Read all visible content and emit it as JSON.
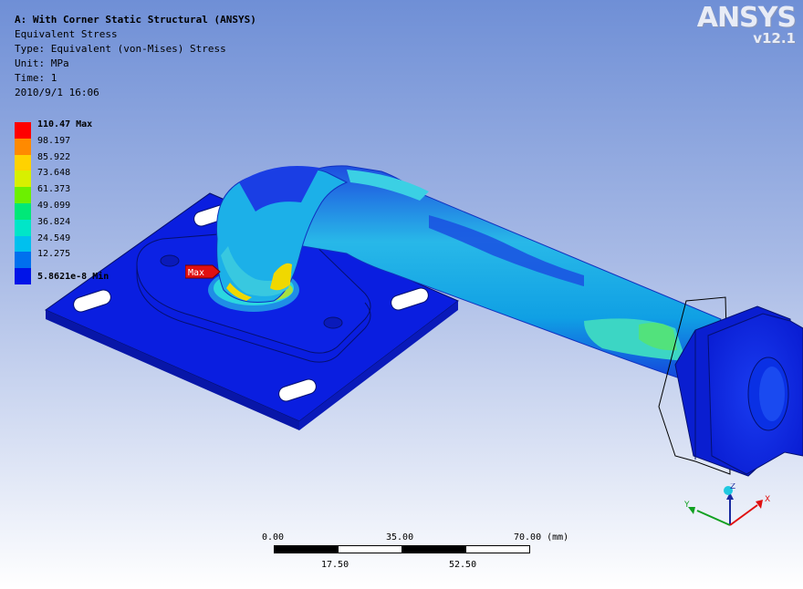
{
  "info": {
    "title": "A: With Corner Static Structural (ANSYS)",
    "result": "Equivalent Stress",
    "type": "Type: Equivalent (von-Mises) Stress",
    "unit": "Unit: MPa",
    "time": "Time: 1",
    "date": "2010/9/1 16:06"
  },
  "logo": {
    "brand": "ANSYS",
    "version": "v12.1"
  },
  "legend": {
    "items": [
      {
        "label": "110.47 Max",
        "color": "#ff0000"
      },
      {
        "label": "98.197",
        "color": "#ff8a00"
      },
      {
        "label": "85.922",
        "color": "#ffd200"
      },
      {
        "label": "73.648",
        "color": "#d8f000"
      },
      {
        "label": "61.373",
        "color": "#6cf000"
      },
      {
        "label": "49.099",
        "color": "#00e878"
      },
      {
        "label": "36.824",
        "color": "#00e6c8"
      },
      {
        "label": "24.549",
        "color": "#00c0ee"
      },
      {
        "label": "12.275",
        "color": "#0070ee"
      },
      {
        "label": "5.8621e-8 Min",
        "color": "#0014e8"
      }
    ]
  },
  "probe": {
    "max_tag": "Max"
  },
  "scale_bar": {
    "top_labels": [
      "0.00",
      "35.00",
      "70.00 (mm)"
    ],
    "bottom_labels": [
      "17.50",
      "52.50"
    ]
  },
  "triad": {
    "x": "X",
    "y": "Y",
    "z": "Z"
  }
}
